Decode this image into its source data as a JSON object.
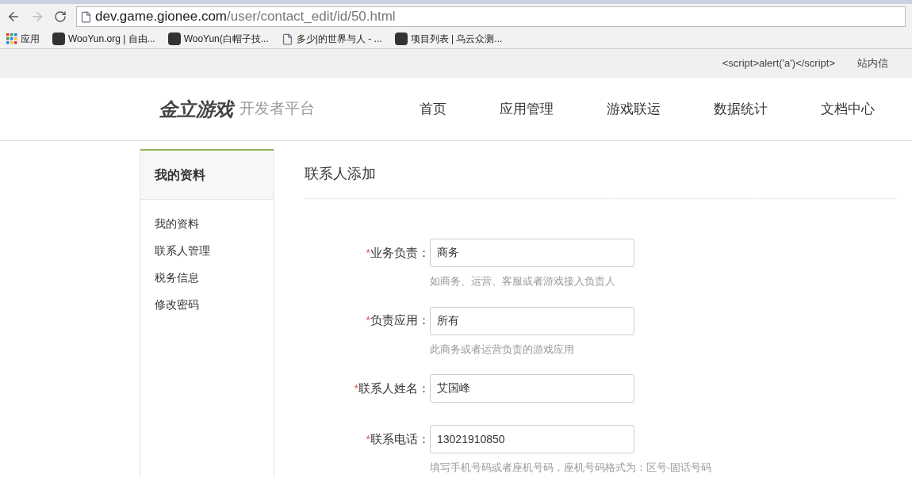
{
  "browser": {
    "url_host": "dev.game.gionee.com",
    "url_path": "/user/contact_edit/id/50.html",
    "bookmarks": [
      {
        "kind": "apps",
        "label": "应用"
      },
      {
        "kind": "site",
        "label": "WooYun.org | 自由..."
      },
      {
        "kind": "site",
        "label": "WooYun(白帽子技..."
      },
      {
        "kind": "page",
        "label": "多少|的世界与人 - ..."
      },
      {
        "kind": "site",
        "label": "项目列表 | 乌云众测..."
      }
    ]
  },
  "top_bar": {
    "links": [
      "<script>alert('a')</script>",
      "站内信"
    ]
  },
  "header": {
    "logo": "金立游戏",
    "logo_subtitle": "开发者平台",
    "nav": [
      "首页",
      "应用管理",
      "游戏联运",
      "数据统计",
      "文档中心"
    ]
  },
  "sidebar": {
    "title": "我的资料",
    "items": [
      "我的资料",
      "联系人管理",
      "税务信息",
      "修改密码"
    ]
  },
  "content": {
    "title": "联系人添加",
    "fields": [
      {
        "label": "业务负责：",
        "required_mark": "*",
        "value": "商务",
        "hint": "如商务、运营、客服或者游戏接入负责人"
      },
      {
        "label": "负责应用：",
        "required_mark": "*",
        "value": "所有",
        "hint": "此商务或者运营负责的游戏应用"
      },
      {
        "label": "联系人姓名：",
        "required_mark": "*",
        "value": "艾国峰"
      },
      {
        "label": "联系电话：",
        "required_mark": "*",
        "value": "13021910850",
        "hint": "填写手机号码或者座机号码，座机号码格式为：区号-固话号码"
      }
    ]
  }
}
